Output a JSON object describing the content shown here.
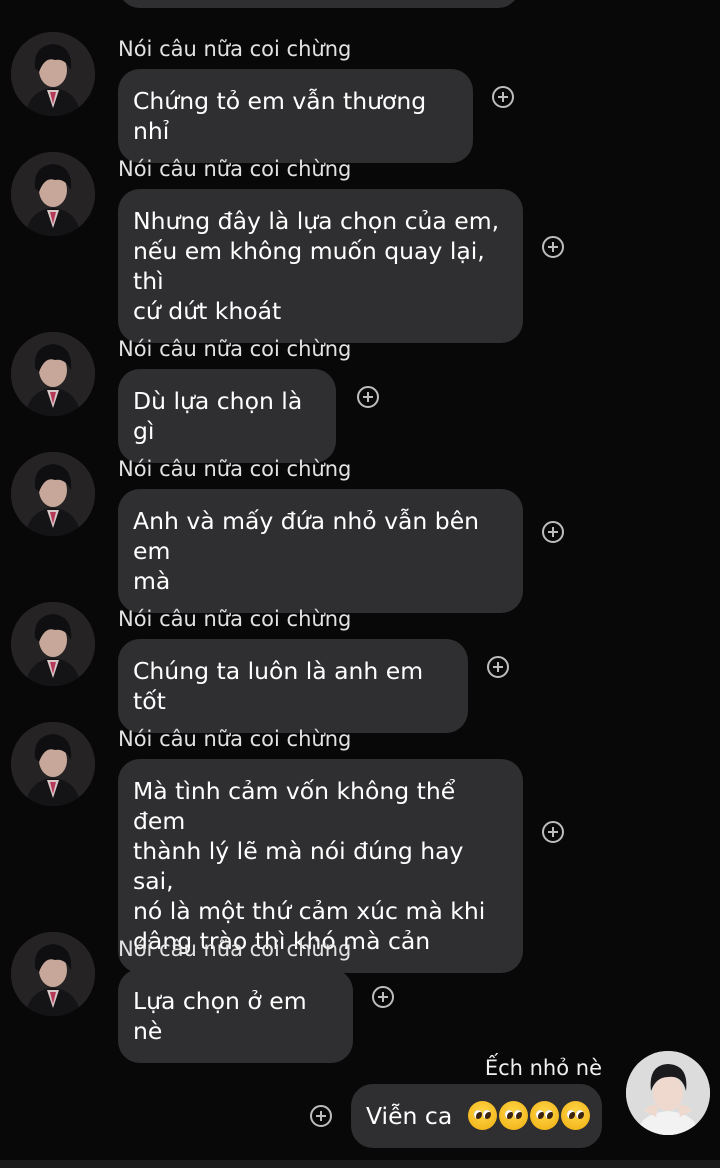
{
  "messages": [
    {
      "sender": "Nói câu nữa coi chừng",
      "text": "Chứng tỏ em vẫn thương nhỉ"
    },
    {
      "sender": "Nói câu nữa coi chừng",
      "text": "Nhưng đây là lựa chọn của em,\nnếu em không muốn quay lại, thì\ncứ dứt khoát"
    },
    {
      "sender": "Nói câu nữa coi chừng",
      "text": "Dù lựa chọn là gì"
    },
    {
      "sender": "Nói câu nữa coi chừng",
      "text": "Anh và mấy đứa nhỏ vẫn bên em\nmà"
    },
    {
      "sender": "Nói câu nữa coi chừng",
      "text": "Chúng ta luôn là anh em tốt"
    },
    {
      "sender": "Nói câu nữa coi chừng",
      "text": "Mà tình cảm vốn không thể đem\nthành lý lẽ mà nói đúng hay sai,\nnó là một thứ cảm xúc mà khi\ndâng trào thì khó mà cản"
    },
    {
      "sender": "Nói câu nữa coi chừng",
      "text": "Lựa chọn ở em nè"
    }
  ],
  "my_message": {
    "sender": "Ếch nhỏ nè",
    "text": "Viễn ca",
    "emoji": [
      "pleading-face",
      "pleading-face",
      "pleading-face",
      "pleading-face"
    ]
  },
  "colors": {
    "background": "#080808",
    "bubble": "#2f2f31",
    "text": "#ffffff",
    "sender_text": "#e2e2e2",
    "react_icon": "#bdbdbd"
  },
  "icons": {
    "react": "plus-circle-icon",
    "emoji": "pleading-face-emoji"
  }
}
